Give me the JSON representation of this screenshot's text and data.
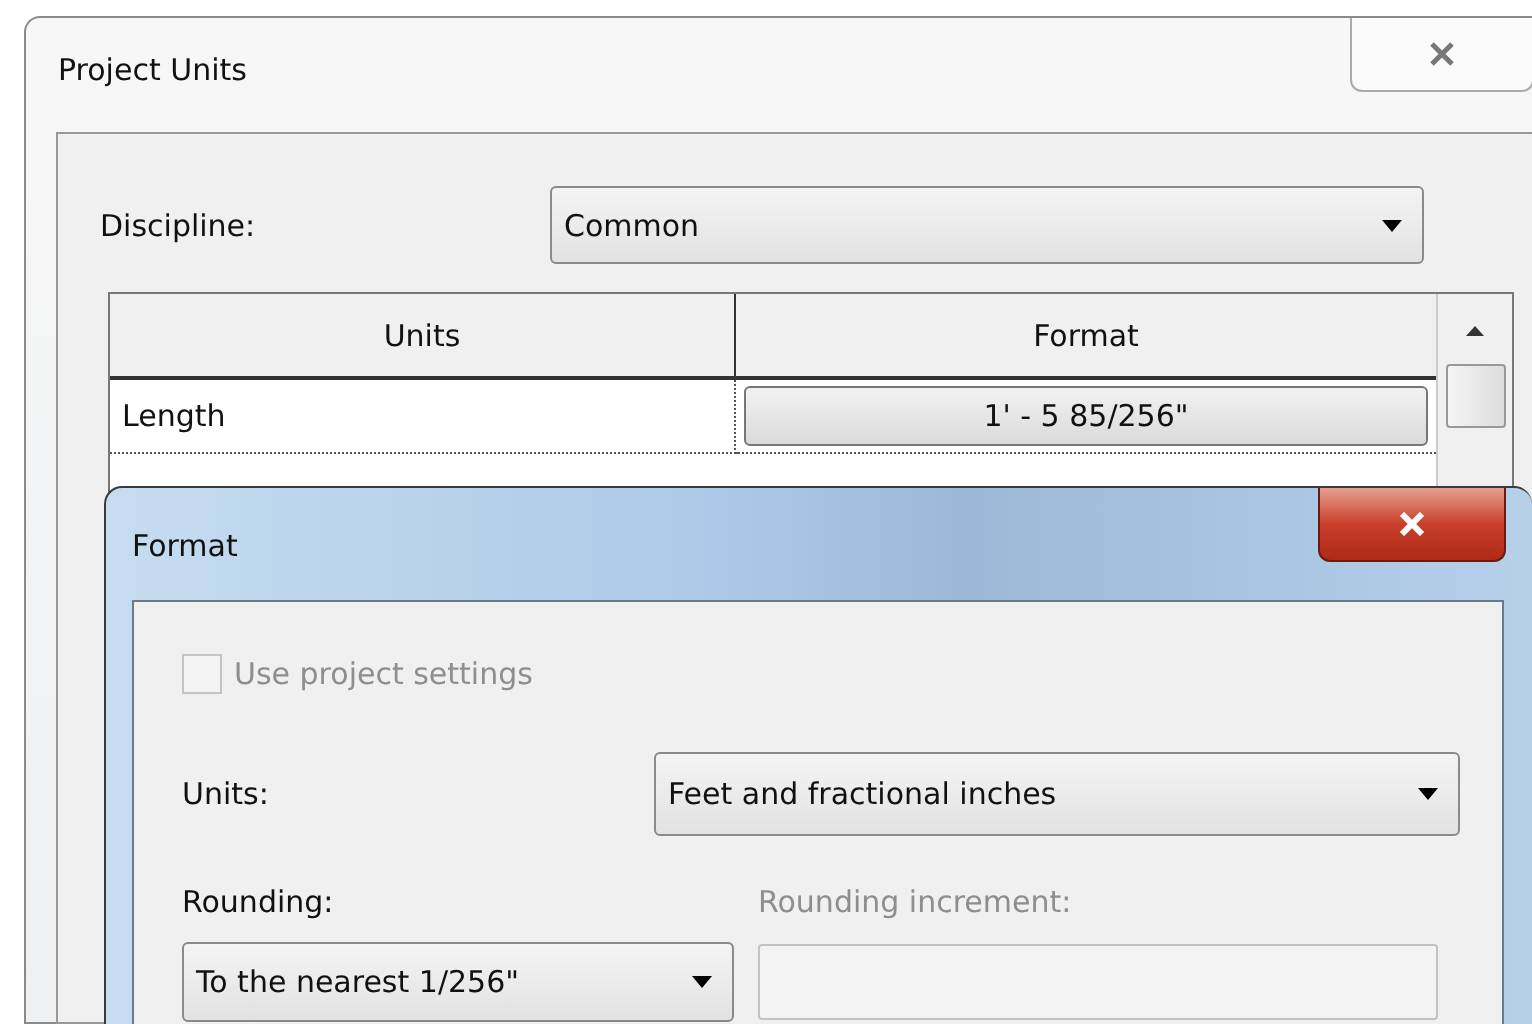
{
  "window": {
    "title": "Project Units"
  },
  "discipline": {
    "label": "Discipline:",
    "value": "Common"
  },
  "table": {
    "columns": [
      "Units",
      "Format"
    ],
    "rows": [
      {
        "unit": "Length",
        "format": "1' - 5 85/256\""
      }
    ]
  },
  "format_dialog": {
    "title": "Format",
    "use_project_settings": {
      "label": "Use project settings",
      "checked": false,
      "disabled": true
    },
    "units": {
      "label": "Units:",
      "value": "Feet and fractional inches"
    },
    "rounding": {
      "label": "Rounding:",
      "value": "To the nearest 1/256\""
    },
    "rounding_increment": {
      "label": "Rounding increment:",
      "disabled": true
    }
  }
}
